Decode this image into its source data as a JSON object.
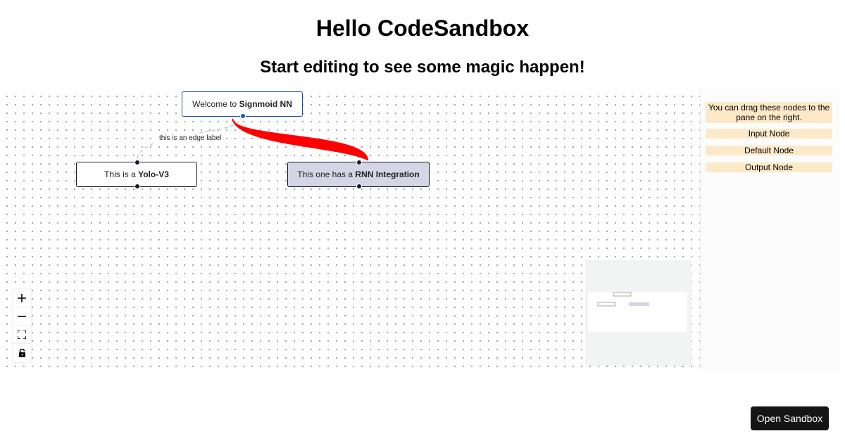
{
  "page": {
    "title": "Hello CodeSandbox",
    "subtitle": "Start editing to see some magic happen!"
  },
  "flow": {
    "nodes": [
      {
        "prefix": "Welcome to ",
        "bold": "Signmoid NN",
        "type": "input"
      },
      {
        "prefix": "This is a ",
        "bold": "Yolo-V3",
        "type": "default"
      },
      {
        "prefix": "This one has a ",
        "bold": "RNN Integration",
        "type": "output"
      }
    ],
    "edge_label": "this is an edge label",
    "edge_color": "#ff0000",
    "node_purple_color": "#d6d5e6"
  },
  "controls": [
    {
      "icon": "zoom-in-icon"
    },
    {
      "icon": "zoom-out-icon"
    },
    {
      "icon": "fit-view-icon"
    },
    {
      "icon": "lock-icon"
    }
  ],
  "sidebar": {
    "description": "You can drag these nodes to the pane on the right.",
    "items": [
      "Input Node",
      "Default Node",
      "Output Node"
    ],
    "item_color": "#fde9c8"
  },
  "open_sandbox_label": "Open Sandbox"
}
